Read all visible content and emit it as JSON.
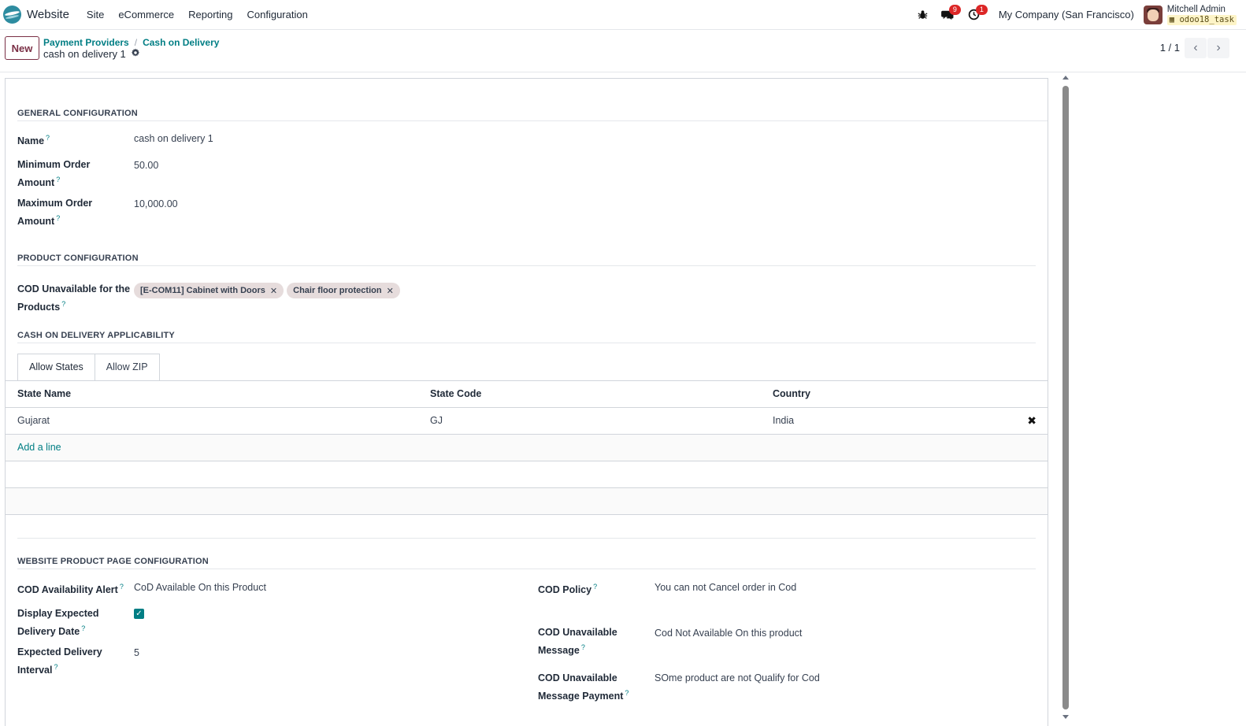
{
  "app": {
    "name": "Website",
    "menu": [
      "Site",
      "eCommerce",
      "Reporting",
      "Configuration"
    ],
    "messages_badge": "9",
    "activities_badge": "1",
    "company": "My Company (San Francisco)",
    "user_name": "Mitchell Admin",
    "database": "odoo18_task"
  },
  "control": {
    "new_label": "New",
    "breadcrumb": [
      "Payment Providers",
      "Cash on Delivery"
    ],
    "breadcrumb_sep": "/",
    "record_title": "cash on delivery 1",
    "pager": "1 / 1"
  },
  "general": {
    "title": "GENERAL CONFIGURATION",
    "name_label": "Name",
    "name_value": "cash on delivery 1",
    "min_label_1": "Minimum Order",
    "min_label_2": "Amount",
    "min_value": "50.00",
    "max_label_1": "Maximum Order",
    "max_label_2": "Amount",
    "max_value": "10,000.00",
    "help": "?"
  },
  "product": {
    "title": "PRODUCT CONFIGURATION",
    "label_1": "COD Unavailable for the",
    "label_2": "Products",
    "tags": [
      "[E-COM11] Cabinet with Doors",
      "Chair floor protection"
    ]
  },
  "applicability": {
    "title": "CASH ON DELIVERY APPLICABILITY",
    "tabs": [
      "Allow States",
      "Allow ZIP"
    ],
    "columns": [
      "State Name",
      "State Code",
      "Country"
    ],
    "rows": [
      {
        "state": "Gujarat",
        "code": "GJ",
        "country": "India"
      }
    ],
    "add_line": "Add a line"
  },
  "website": {
    "title": "WEBSITE PRODUCT PAGE CONFIGURATION",
    "alert_label": "COD Availability Alert",
    "alert_value": "CoD Available On this Product",
    "display_label_1": "Display Expected",
    "display_label_2": "Delivery Date",
    "display_checked": true,
    "interval_label_1": "Expected Delivery",
    "interval_label_2": "Interval",
    "interval_value": "5",
    "policy_label": "COD Policy",
    "policy_value": "You can not Cancel order in Cod",
    "unavail_msg_label_1": "COD Unavailable",
    "unavail_msg_label_2": "Message",
    "unavail_msg_value": "Cod Not Available On this product",
    "unavail_pay_label_1": "COD Unavailable",
    "unavail_pay_label_2": "Message Payment",
    "unavail_pay_value": "SOme product are not Qualify for Cod"
  },
  "colors": {
    "accent": "#017e84",
    "primary": "#7a2f45",
    "badge": "#dc2626"
  },
  "icons": [
    "bug-icon",
    "chat-icon",
    "clock-icon",
    "gear-icon",
    "chevron-left-icon",
    "chevron-right-icon",
    "close-icon",
    "check-icon"
  ]
}
